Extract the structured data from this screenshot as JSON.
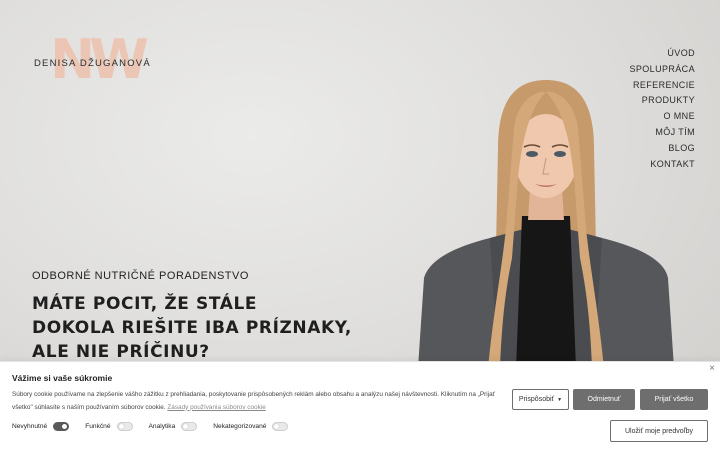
{
  "logo": {
    "mark": "NW",
    "name": "DENISA DŽUGANOVÁ"
  },
  "nav": [
    "ÚVOD",
    "SPOLUPRÁCA",
    "REFERENCIE",
    "PRODUKTY",
    "O MNE",
    "MÔJ TÍM",
    "BLOG",
    "KONTAKT"
  ],
  "hero": {
    "eyebrow": "ODBORNÉ NUTRIČNÉ PORADENSTVO",
    "headline": [
      "MÁTE POCIT, ŽE STÁLE",
      "DOKOLA RIEŠITE IBA PRÍZNAKY,",
      "ALE NIE PRÍČINU?"
    ]
  },
  "cookie": {
    "title": "Vážime si vaše súkromie",
    "text": "Súbory cookie používame na zlepšenie vášho zážitku z prehliadania, poskytovanie prispôsobených reklám alebo obsahu a analýzu našej návštevnosti. Kliknutím na „Prijať všetko\" súhlasíte s naším používaním súborov cookie.",
    "link": "Zásady používania súborov cookie",
    "close": "×",
    "toggles": [
      "Nevyhnutné",
      "Funkčné",
      "Analytika",
      "Nekategorizované"
    ],
    "buttons": {
      "customize": "Prispôsobiť",
      "reject": "Odmietnuť",
      "accept": "Prijať všetko",
      "save": "Uložiť moje predvoľby"
    }
  },
  "colors": {
    "accent": "#6e6e6e",
    "logo": "#eec1ae"
  }
}
